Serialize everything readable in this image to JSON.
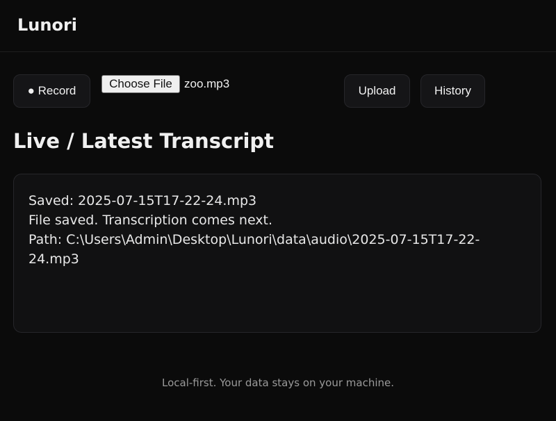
{
  "header": {
    "brand": "Lunori"
  },
  "toolbar": {
    "record_label": "● Record",
    "choose_file_label": "Choose File",
    "file_name": "zoo.mp3",
    "upload_label": "Upload",
    "history_label": "History"
  },
  "main": {
    "title": "Live / Latest Transcript",
    "transcript_lines": [
      "Saved: 2025-07-15T17-22-24.mp3",
      "File saved. Transcription comes next.",
      "Path: C:\\Users\\Admin\\Desktop\\Lunori\\data\\audio\\2025-07-15T17-22-24.mp3"
    ]
  },
  "footer": {
    "text": "Local-first. Your data stays on your machine."
  }
}
